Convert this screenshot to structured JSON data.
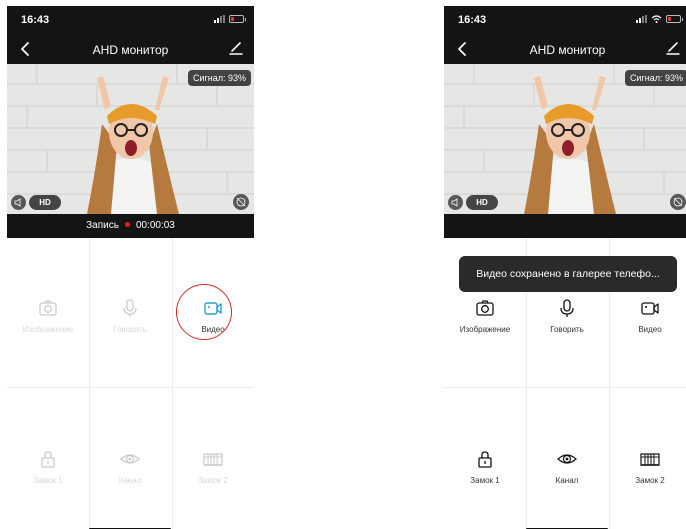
{
  "status_bar": {
    "time": "16:43"
  },
  "header": {
    "title": "AHD монитор"
  },
  "video": {
    "signal": "Сигнал: 93%",
    "hd_label": "HD"
  },
  "recording": {
    "label": "Запись",
    "timer": "00:00:03"
  },
  "controls": {
    "image": "Изображение",
    "talk": "Говорить",
    "video": "Видео",
    "lock1": "Замок 1",
    "channel": "Канал",
    "lock2": "Замок 2"
  },
  "toast": {
    "message": "Видео сохранено в галерее телефо..."
  },
  "colors": {
    "bar_background": "#141414",
    "active_blue": "#2a9bd4",
    "record_red": "#e32121",
    "highlight_red": "#d62828"
  }
}
